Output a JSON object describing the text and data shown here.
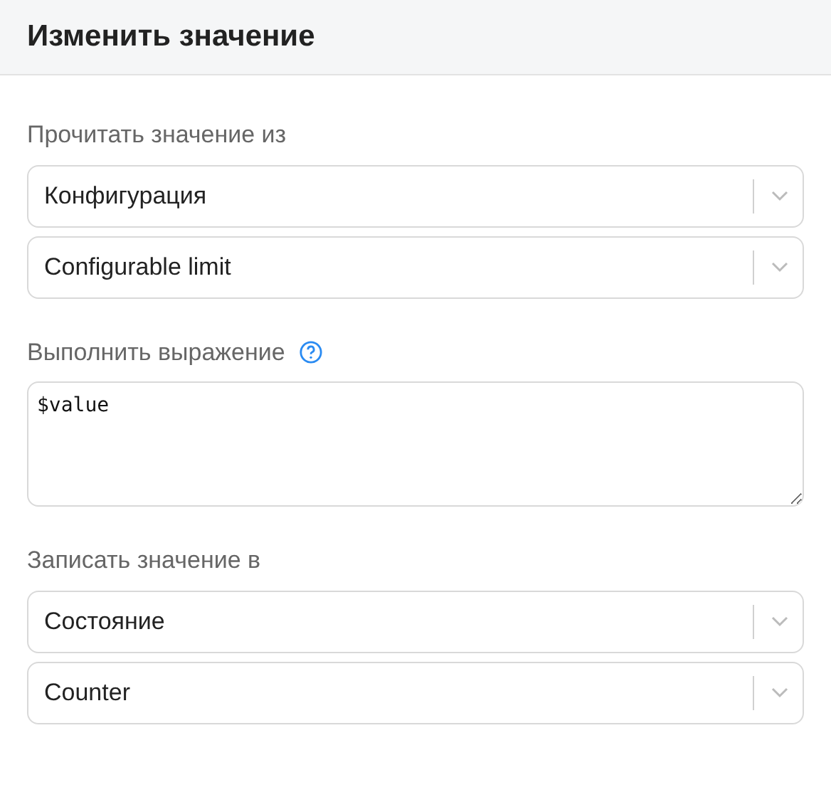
{
  "header": {
    "title": "Изменить значение"
  },
  "read": {
    "label": "Прочитать значение из",
    "selects": [
      {
        "value": "Конфигурация"
      },
      {
        "value": "Configurable limit"
      }
    ]
  },
  "expression": {
    "label": "Выполнить выражение",
    "value": "$value"
  },
  "write": {
    "label": "Записать значение в",
    "selects": [
      {
        "value": "Состояние"
      },
      {
        "value": "Counter"
      }
    ]
  }
}
